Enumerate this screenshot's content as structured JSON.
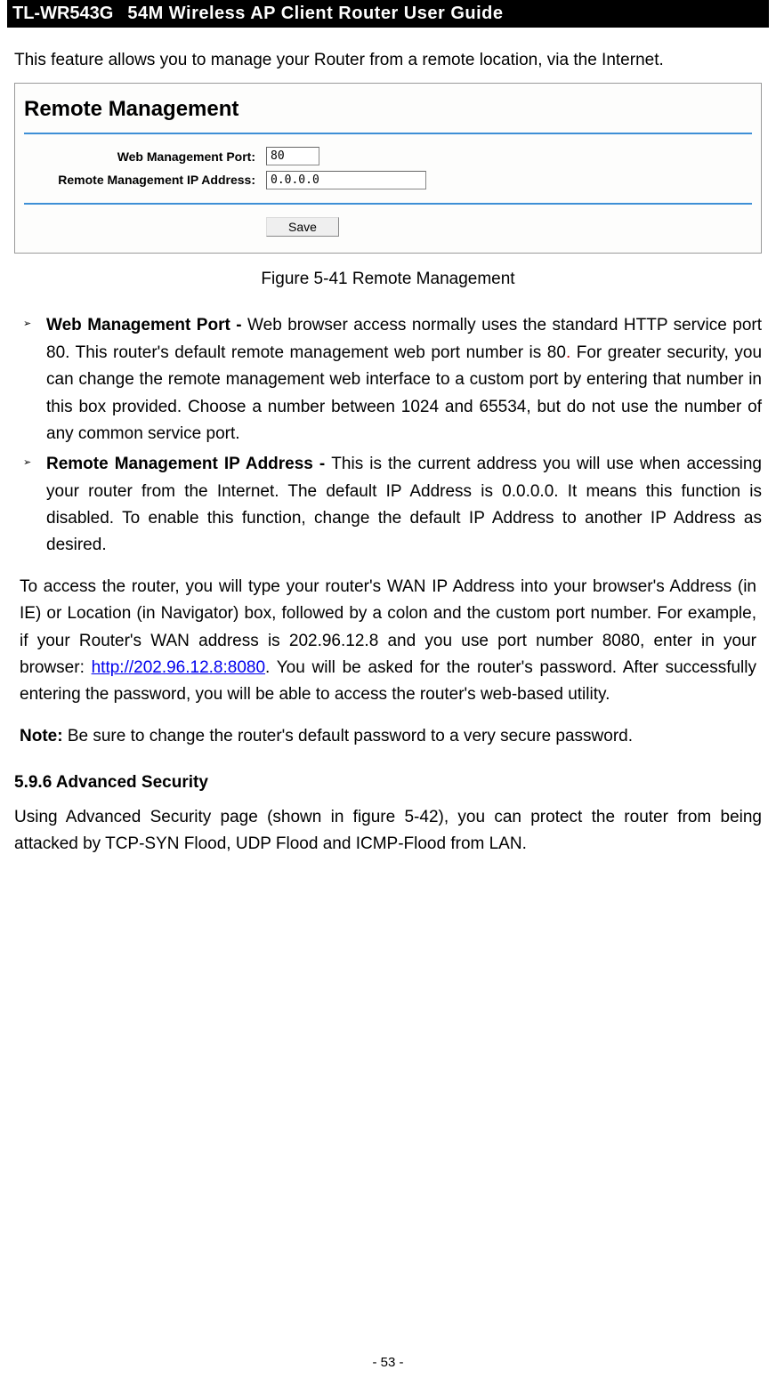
{
  "header": {
    "model": "TL-WR543G",
    "title": "54M Wireless AP Client Router User Guide"
  },
  "intro": "This feature allows you to manage your Router from a remote location, via the Internet.",
  "panel": {
    "title": "Remote Management",
    "port_label": "Web Management Port:",
    "port_value": "80",
    "ip_label": "Remote Management IP Address:",
    "ip_value": "0.0.0.0",
    "save_label": "Save"
  },
  "figure_caption": "Figure 5-41    Remote Management",
  "bullets": {
    "b1_label": "Web Management Port - ",
    "b1_text_a": "Web browser access normally uses the standard HTTP service port 80. This router's default remote management web port number is 80",
    "b1_dot": ".",
    "b1_text_b": " For greater security, you can change the remote management web interface to a custom port by entering that number in this box provided. Choose a number between 1024 and 65534, but do not use the number of any common service port.",
    "b2_label": "Remote Management IP Address - ",
    "b2_text": "This is the current address you will use when accessing your router from the Internet. The default IP Address is 0.0.0.0. It means this function is disabled. To enable this function, change the default IP Address to another IP Address as desired."
  },
  "paragraph_a": "To access the router, you will type your router's WAN IP Address into your browser's Address (in IE) or Location (in Navigator) box, followed by a colon and the custom port number. For example, if your Router's WAN address is 202.96.12.8 and you use port number 8080, enter in your browser: ",
  "example_url": "http://202.96.12.8:8080",
  "paragraph_b": ". You will be asked for the router's password. After successfully entering the password, you will be able to access the router's web-based utility.",
  "note_label": "Note: ",
  "note_text": "Be sure to change the router's default password to a very secure password.",
  "section_heading": "5.9.6 Advanced Security",
  "section_text": "Using Advanced Security page (shown in figure 5-42), you can protect the router from being attacked by TCP-SYN Flood, UDP Flood and ICMP-Flood from LAN.",
  "page_number": "- 53 -"
}
